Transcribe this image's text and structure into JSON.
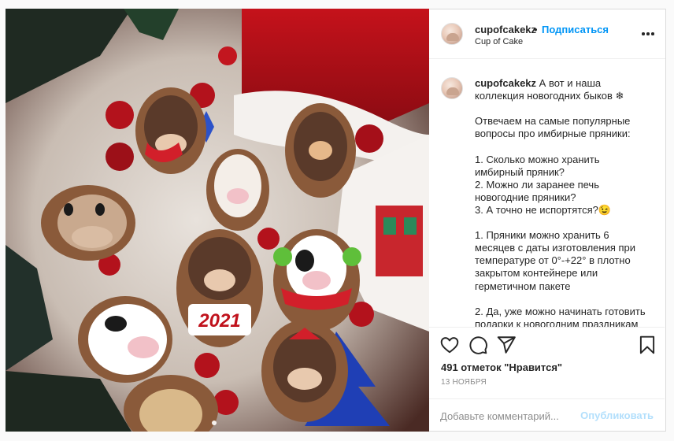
{
  "header": {
    "username": "cupofcakekz",
    "separator": "•",
    "follow_label": "Подписаться",
    "subtitle": "Cup of Cake"
  },
  "caption": {
    "username": "cupofcakekz",
    "text": " А вот и наша\nколлекция новогодних быков ❄\n\nОтвечаем на самые популярные\nвопросы про имбирные пряники:\n\n1. Сколько можно хранить\nимбирный пряник?\n2. Можно ли заранее печь\nновогодние пряники?\n3. А точно не испортятся?😉\n\n1. Пряники можно хранить 6\nмесяцев с даты изготовления при\nтемпературе от 0°-+22° в плотно\nзакрытом контейнере или\nгерметичном пакете\n\n2. Да, уже можно начинать готовить\nподарки к новогодним праздникам"
  },
  "icons": {
    "like": "heart-icon",
    "comment": "comment-icon",
    "share": "share-icon",
    "save": "bookmark-icon",
    "more": "more-icon"
  },
  "likes_text": "491 отметок \"Нравится\"",
  "date_text": "13 НОЯБРЯ",
  "comment_box": {
    "placeholder": "Добавьте комментарий...",
    "publish_label": "Опубликовать"
  },
  "photo_text": "2021",
  "colors": {
    "accent": "#0095f6",
    "publish_disabled": "#b2dffc",
    "muted": "#8e8e8e"
  }
}
